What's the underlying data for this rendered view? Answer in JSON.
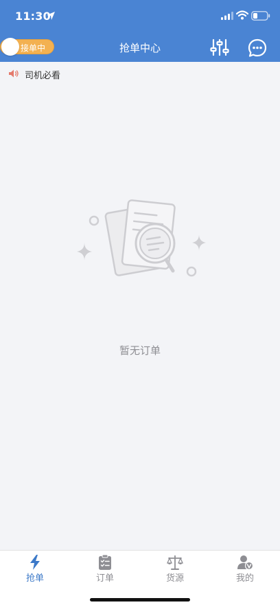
{
  "status_bar": {
    "time": "11:30"
  },
  "nav": {
    "toggle_label": "接单中",
    "title": "抢单中心",
    "icons": [
      "filter-icon",
      "chat-icon"
    ]
  },
  "notice": {
    "text": "司机必看",
    "icon": "speaker-icon"
  },
  "empty_state": {
    "text": "暂无订单",
    "icon": "empty-documents-illustration"
  },
  "tabs": [
    {
      "label": "抢单",
      "icon": "lightning-icon",
      "active": true
    },
    {
      "label": "订单",
      "icon": "clipboard-icon",
      "active": false
    },
    {
      "label": "货源",
      "icon": "scale-icon",
      "active": false
    },
    {
      "label": "我的",
      "icon": "user-badge-icon",
      "active": false
    }
  ],
  "colors": {
    "header": "#4a84d3",
    "toggle": "#f3b151",
    "active_tab": "#3c79c8",
    "inactive_tab": "#8e8e93",
    "background": "#f3f4f7"
  }
}
